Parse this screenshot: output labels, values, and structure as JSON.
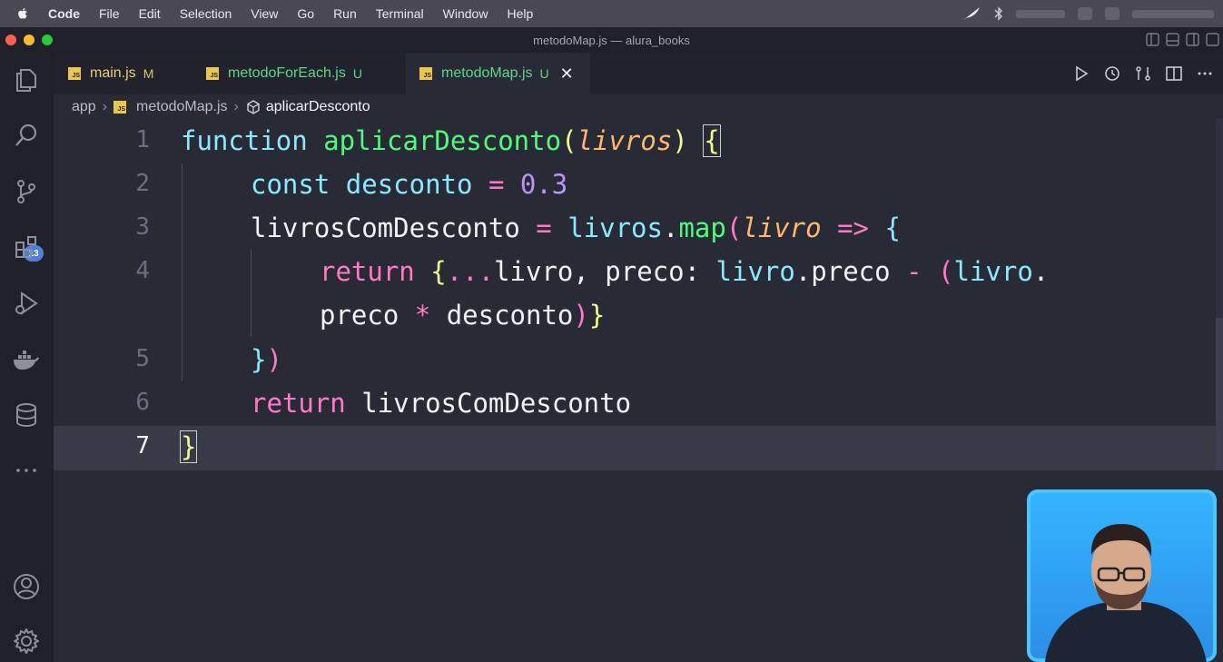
{
  "menubar": {
    "items": [
      "Code",
      "File",
      "Edit",
      "Selection",
      "View",
      "Go",
      "Run",
      "Terminal",
      "Window",
      "Help"
    ]
  },
  "window": {
    "title": "metodoMap.js — alura_books"
  },
  "activity_bar": {
    "source_control_badge": "13",
    "icons": [
      "explorer-icon",
      "search-icon",
      "source-control-icon",
      "extensions-icon",
      "run-debug-icon",
      "docker-icon",
      "database-icon",
      "more-icon",
      "account-icon",
      "gear-icon"
    ]
  },
  "tabs": [
    {
      "label": "main.js",
      "status": "M",
      "active": false
    },
    {
      "label": "metodoForEach.js",
      "status": "U",
      "active": false
    },
    {
      "label": "metodoMap.js",
      "status": "U",
      "active": true
    }
  ],
  "breadcrumb": {
    "folder": "app",
    "file": "metodoMap.js",
    "symbol": "aplicarDesconto"
  },
  "editor": {
    "line_numbers": [
      "1",
      "2",
      "3",
      "4",
      "5",
      "6",
      "7"
    ],
    "current_line": "7",
    "lines": {
      "l1": {
        "kw": "function",
        "name": "aplicarDesconto",
        "open": "(",
        "param": "livros",
        "close": ")",
        "brace": "{"
      },
      "l2": {
        "kw": "const",
        "var": "desconto",
        "eq": "=",
        "num": "0.3"
      },
      "l3": {
        "var": "livrosComDesconto",
        "eq": "=",
        "obj": "livros",
        "dot": ".",
        "method": "map",
        "open": "(",
        "param": "livro",
        "arrow": "=>",
        "brace": "{"
      },
      "l4": {
        "kw": "return",
        "brace": "{",
        "spread": "...",
        "rest1": "livro, preco: ",
        "obj": "livro",
        "rest2": ".preco",
        "minus": "-",
        "paren": "(",
        "obj2": "livro",
        "dot": "."
      },
      "l4b": {
        "rest": "preco ",
        "mul": "*",
        "rest2": " desconto",
        "paren": ")",
        "brace": "}"
      },
      "l5": {
        "brace": "}",
        "paren": ")"
      },
      "l6": {
        "kw": "return",
        "var": "livrosComDesconto"
      },
      "l7": {
        "brace": "}"
      }
    }
  },
  "colors": {
    "background": "#282a36",
    "keyword": "#8be9fd",
    "function": "#50fa7b",
    "parameter": "#ffb86c",
    "pink": "#ff79c6",
    "number": "#bd93f9",
    "bracket": "#f1fa8c",
    "badge": "#4e7fe0"
  }
}
